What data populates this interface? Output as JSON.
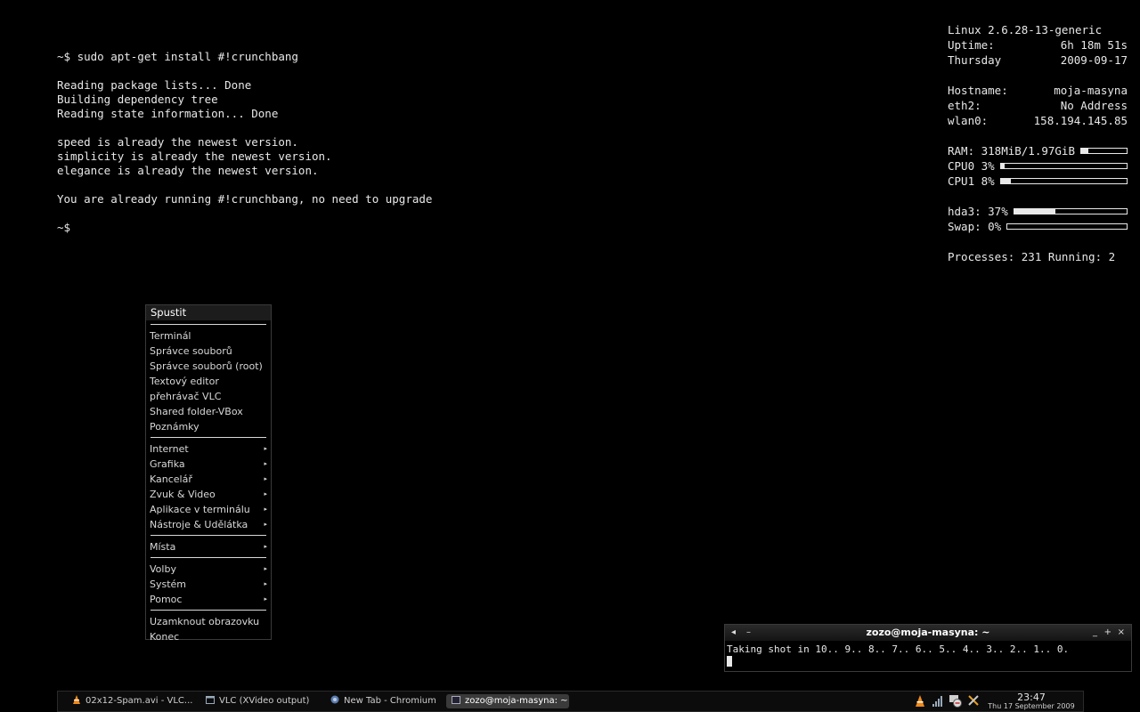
{
  "terminal": {
    "lines": [
      "~$ sudo apt-get install #!crunchbang",
      "",
      "Reading package lists... Done",
      "Building dependency tree",
      "Reading state information... Done",
      "",
      "speed is already the newest version.",
      "simplicity is already the newest version.",
      "elegance is already the newest version.",
      "",
      "You are already running #!crunchbang, no need to upgrade",
      "",
      "~$"
    ]
  },
  "conky": {
    "kernel": "Linux 2.6.28-13-generic",
    "uptime_label": "Uptime:",
    "uptime_value": "6h 18m 51s",
    "day": "Thursday",
    "date": "2009-09-17",
    "hostname_label": "Hostname:",
    "hostname_value": "moja-masyna",
    "eth2_label": "eth2:",
    "eth2_value": "No Address",
    "wlan0_label": "wlan0:",
    "wlan0_value": "158.194.145.85",
    "ram_label": "RAM: 318MiB/1.97GiB",
    "ram_fraction": 0.16,
    "cpu0_label": "CPU0 3%",
    "cpu0_fraction": 0.03,
    "cpu1_label": "CPU1 8%",
    "cpu1_fraction": 0.08,
    "hda3_label": "hda3: 37%",
    "hda3_fraction": 0.37,
    "swap_label": "Swap: 0%",
    "swap_fraction": 0.0,
    "processes": "Processes: 231 Running: 2"
  },
  "menu": {
    "title": "Spustit",
    "group1": [
      "Terminál",
      "Správce souborů",
      "Správce souborů (root)",
      "Textový editor",
      "přehrávač VLC",
      "Shared folder-VBox",
      "Poznámky"
    ],
    "group2": [
      "Internet",
      "Grafika",
      "Kancelář",
      "Zvuk & Video",
      "Aplikace v terminálu",
      "Nástroje & Udělátka"
    ],
    "group3": [
      "Místa"
    ],
    "group4": [
      "Volby",
      "Systém",
      "Pomoc"
    ],
    "group5": [
      "Uzamknout obrazovku",
      "Konec"
    ],
    "submenu_arrow": "▸"
  },
  "mini_terminal": {
    "title": "zozo@moja-masyna: ~",
    "left_buttons": [
      "◂",
      "–"
    ],
    "right_buttons": [
      "_",
      "+",
      "×"
    ],
    "output": "Taking shot in 10.. 9.. 8.. 7.. 6.. 5.. 4.. 3.. 2.. 1.. 0."
  },
  "taskbar": {
    "tasks": [
      {
        "label": "02x12-Spam.avi - VLC...",
        "icon": "vlc-icon",
        "active": false
      },
      {
        "label": "VLC (XVideo output)",
        "icon": "window-icon",
        "active": false
      },
      {
        "label": "New Tab - Chromium",
        "icon": "chromium-icon",
        "active": false
      },
      {
        "label": "zozo@moja-masyna: ~",
        "icon": "terminal-icon",
        "active": true
      }
    ],
    "tray_icons": [
      "vlc-tray-icon",
      "signal-icon",
      "network-icon",
      "tools-icon"
    ],
    "clock_time": "23:47",
    "clock_date": "Thu 17 September 2009"
  },
  "colors": {
    "background": "#000000",
    "text": "#e8e8e8",
    "vlc_orange": "#f08a1c",
    "active_task": "#3a3a3a"
  }
}
